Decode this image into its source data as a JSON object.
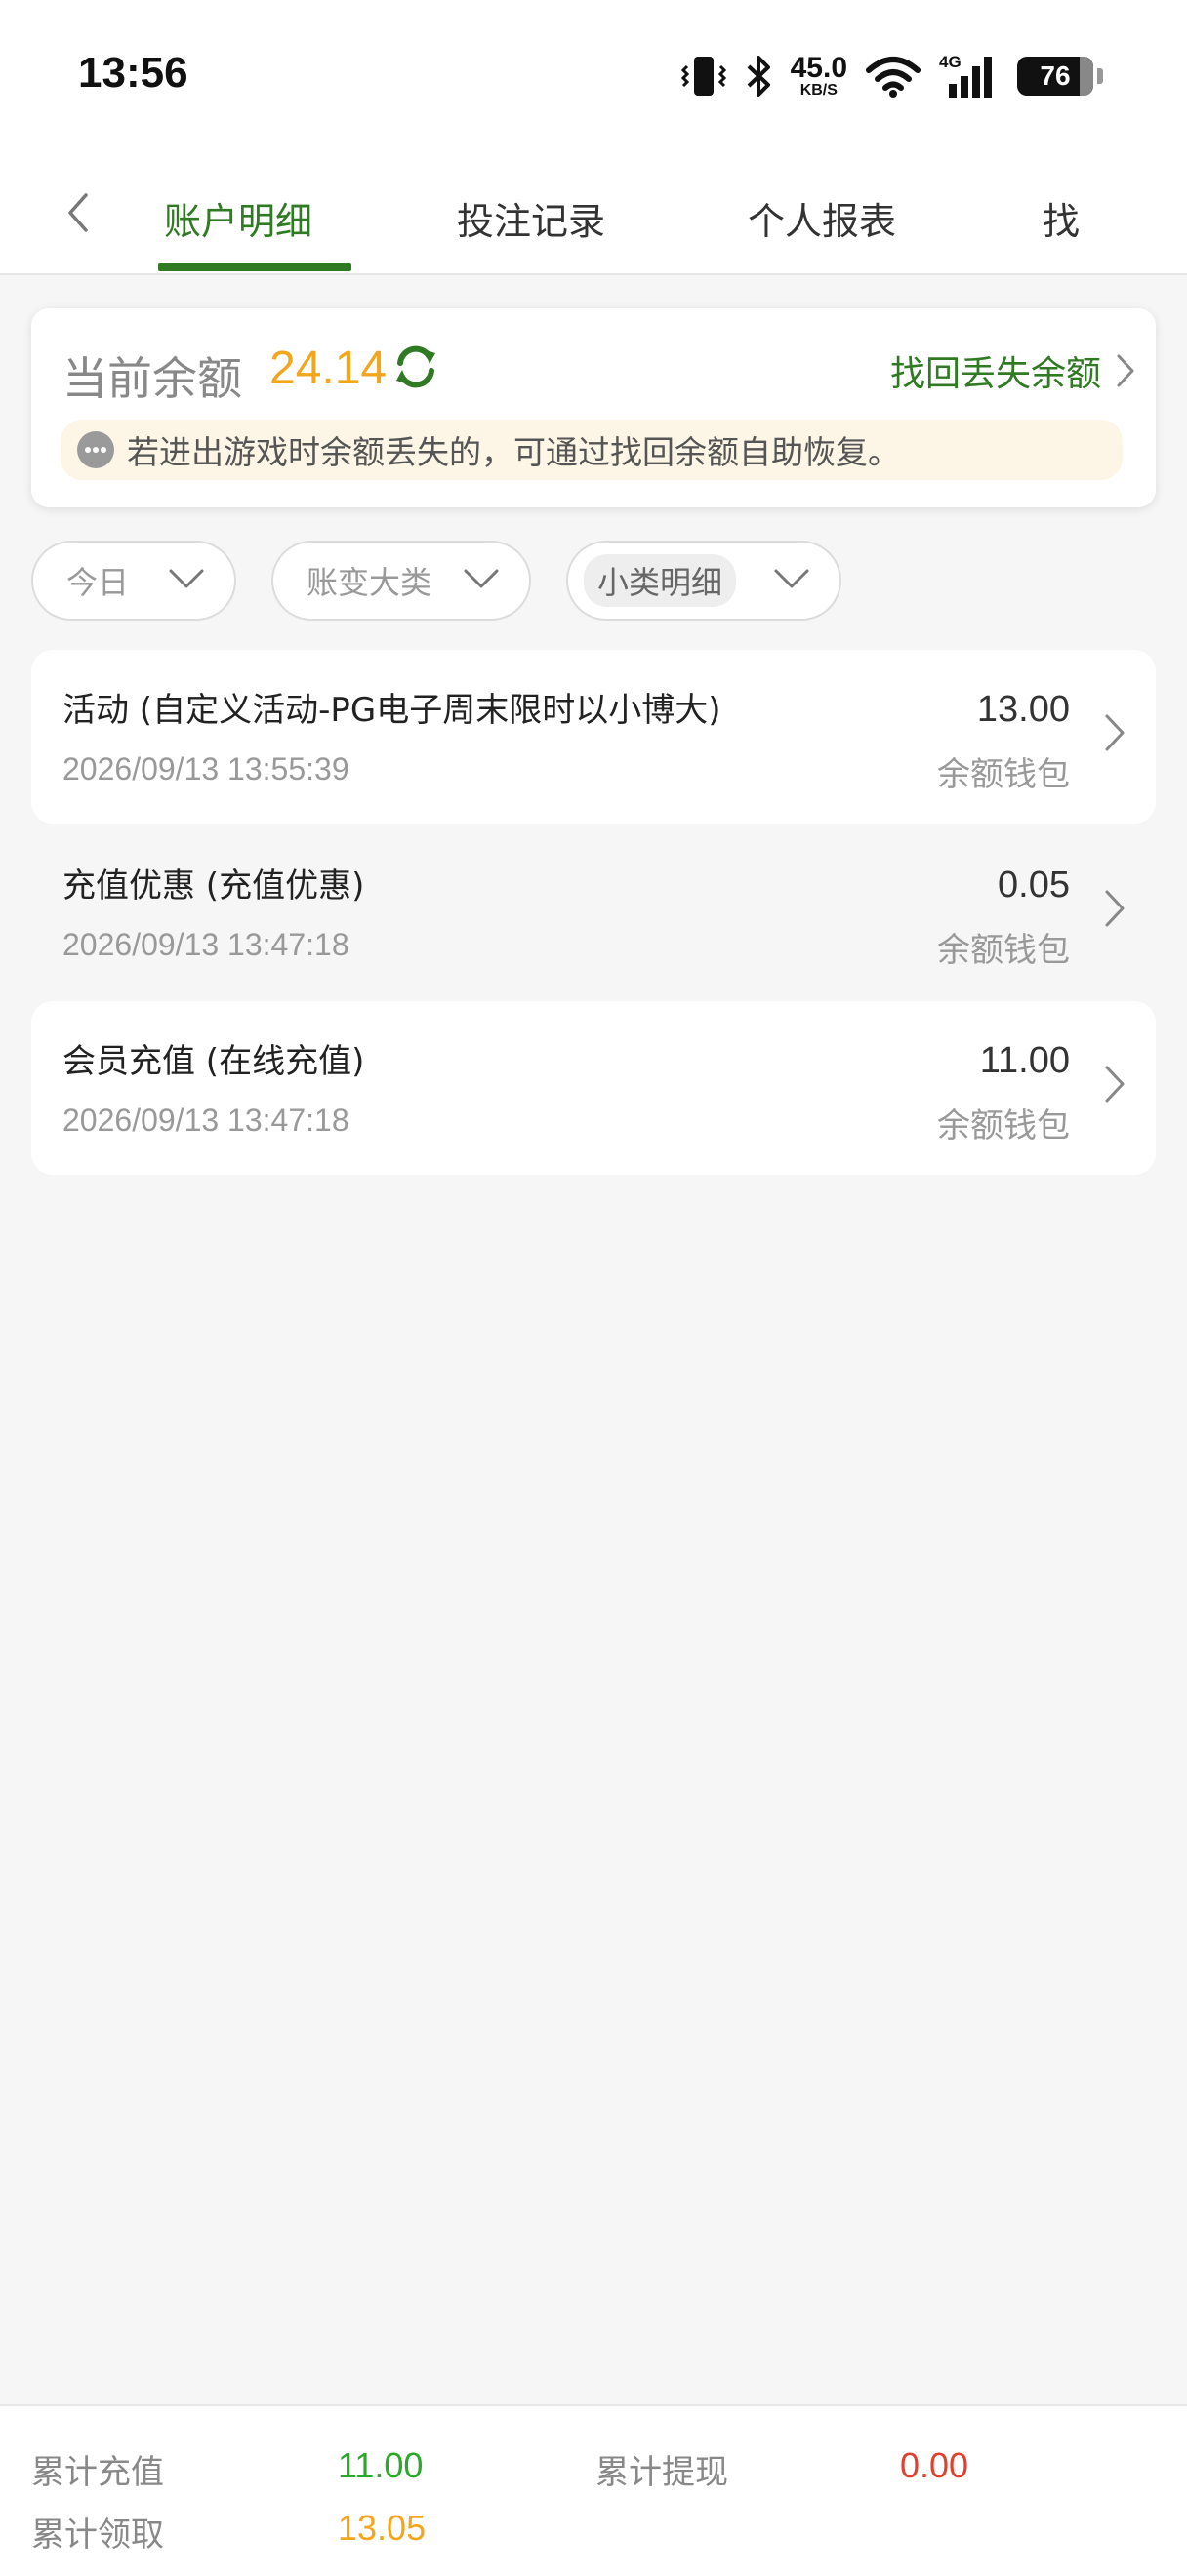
{
  "status_bar": {
    "time": "13:56",
    "net_speed_value": "45.0",
    "net_speed_unit": "KB/S",
    "network_type": "4G",
    "battery": "76",
    "icons": [
      "vibrate-icon",
      "bluetooth-icon",
      "wifi-icon",
      "signal-icon",
      "battery-icon"
    ]
  },
  "tabs": {
    "items": [
      {
        "label": "账户明细",
        "active": true
      },
      {
        "label": "投注记录",
        "active": false
      },
      {
        "label": "个人报表",
        "active": false
      },
      {
        "label": "找",
        "active": false
      }
    ]
  },
  "balance": {
    "label": "当前余额",
    "value": "24.14",
    "recover_label": "找回丢失余额",
    "notice": "若进出游戏时余额丢失的，可通过找回余额自助恢复。"
  },
  "filters": {
    "date": "今日",
    "category": "账变大类",
    "subcategory": "小类明细"
  },
  "records": [
    {
      "title": "活动 (自定义活动-PG电子周末限时以小博大)",
      "time": "2026/09/13 13:55:39",
      "amount": "13.00",
      "wallet": "余额钱包"
    },
    {
      "title": "充值优惠 (充值优惠)",
      "time": "2026/09/13 13:47:18",
      "amount": "0.05",
      "wallet": "余额钱包"
    },
    {
      "title": "会员充值 (在线充值)",
      "time": "2026/09/13 13:47:18",
      "amount": "11.00",
      "wallet": "余额钱包"
    }
  ],
  "totals": {
    "deposit_label": "累计充值",
    "deposit_value": "11.00",
    "withdraw_label": "累计提现",
    "withdraw_value": "0.00",
    "claim_label": "累计领取",
    "claim_value": "13.05"
  },
  "colors": {
    "accent_green": "#2f7a23",
    "balance_orange": "#f2a61d",
    "deposit_green": "#2aa82a",
    "withdraw_red": "#e0402e",
    "claim_orange": "#f2a61d"
  }
}
